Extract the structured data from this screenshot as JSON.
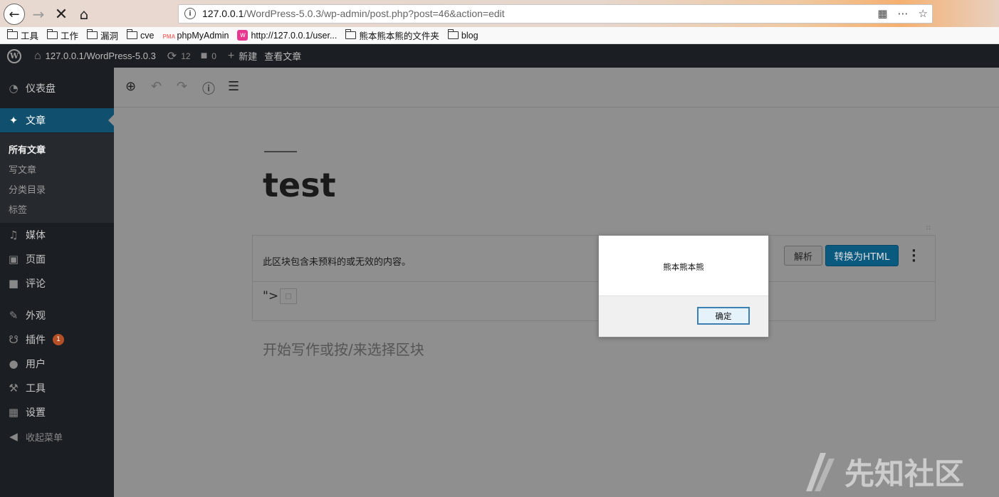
{
  "browser": {
    "url_host": "127.0.0.1",
    "url_path": "/WordPress-5.0.3/wp-admin/post.php?post=46&action=edit",
    "bookmarks": [
      {
        "label": "工具",
        "icon": "folder-icon"
      },
      {
        "label": "工作",
        "icon": "folder-icon"
      },
      {
        "label": "漏洞",
        "icon": "folder-icon"
      },
      {
        "label": "cve",
        "icon": "folder-icon"
      },
      {
        "label": "phpMyAdmin",
        "icon": "phpmyadmin-icon"
      },
      {
        "label": "http://127.0.0.1/user...",
        "icon": "site-icon"
      },
      {
        "label": "熊本熊本熊的文件夹",
        "icon": "folder-icon"
      },
      {
        "label": "blog",
        "icon": "folder-icon"
      }
    ]
  },
  "admin_bar": {
    "site": "127.0.0.1/WordPress-5.0.3",
    "updates": "12",
    "comments": "0",
    "new": "新建",
    "view": "查看文章"
  },
  "sidebar": {
    "items": {
      "dashboard": "仪表盘",
      "posts": "文章",
      "media": "媒体",
      "pages": "页面",
      "comments": "评论",
      "appearance": "外观",
      "plugins": "插件",
      "plugins_badge": "1",
      "users": "用户",
      "tools": "工具",
      "settings": "设置",
      "collapse": "收起菜单"
    },
    "submenu": {
      "all_posts": "所有文章",
      "new_post": "写文章",
      "categories": "分类目录",
      "tags": "标签"
    }
  },
  "editor": {
    "title": "test",
    "block_warning": "此区块包含未预料的或无效的内容。",
    "parse_button": "解析",
    "convert_button": "转换为HTML",
    "block_content": "\">",
    "placeholder": "开始写作或按/来选择区块"
  },
  "dialog": {
    "message": "熊本熊本熊",
    "ok": "确定"
  },
  "watermark": "先知社区"
}
